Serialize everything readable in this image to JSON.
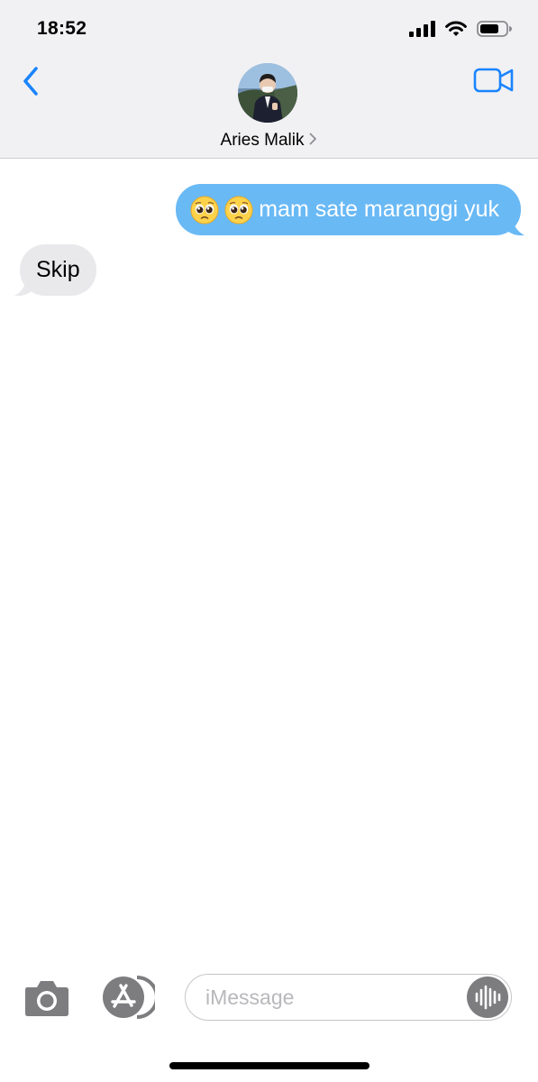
{
  "status_bar": {
    "time": "18:52"
  },
  "header": {
    "contact_name": "Aries Malik"
  },
  "messages": [
    {
      "direction": "outgoing",
      "emoji": "pleading-face",
      "emoji_count": 2,
      "text": "mam sate maranggi yuk"
    },
    {
      "direction": "incoming",
      "text": "Skip"
    }
  ],
  "composer": {
    "placeholder": "iMessage",
    "value": ""
  },
  "colors": {
    "accent": "#1a84ff",
    "outgoing_bubble": "#69b9f5",
    "incoming_bubble": "#e9e9eb",
    "header_bg": "#f1f1f3",
    "icon_gray": "#7d7d80"
  },
  "icons": [
    "back-chevron-icon",
    "avatar",
    "video-camera-icon",
    "camera-icon",
    "app-store-icon",
    "audio-waveform-icon",
    "signal-icon",
    "wifi-icon",
    "battery-icon"
  ]
}
